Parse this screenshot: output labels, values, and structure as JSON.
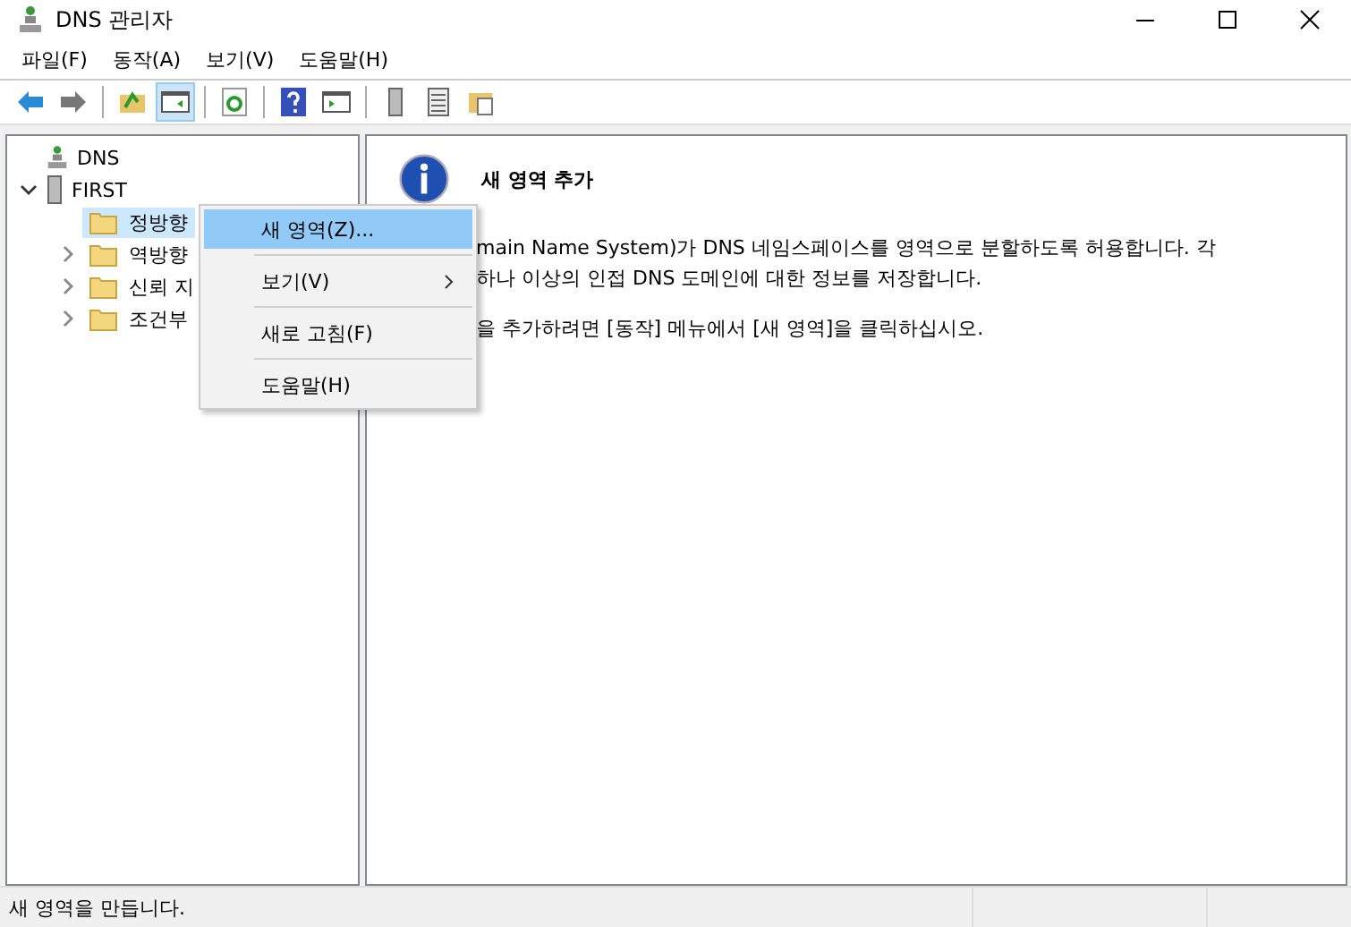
{
  "window": {
    "title": "DNS 관리자"
  },
  "menu": [
    "파일(F)",
    "동작(A)",
    "보기(V)",
    "도움말(H)"
  ],
  "toolbar": [
    {
      "kind": "back",
      "pressed": false
    },
    {
      "kind": "forward",
      "pressed": false
    },
    {
      "kind": "sep"
    },
    {
      "kind": "up",
      "pressed": false
    },
    {
      "kind": "pane",
      "pressed": true
    },
    {
      "kind": "sep"
    },
    {
      "kind": "refresh",
      "pressed": false
    },
    {
      "kind": "sep"
    },
    {
      "kind": "help",
      "pressed": false
    },
    {
      "kind": "action",
      "pressed": false
    },
    {
      "kind": "sep"
    },
    {
      "kind": "server",
      "pressed": false
    },
    {
      "kind": "list",
      "pressed": false
    },
    {
      "kind": "folder",
      "pressed": false
    }
  ],
  "tree": {
    "label": "DNS",
    "children": [
      {
        "label": "FIRST",
        "expanded": true,
        "children": [
          {
            "label": "정방향",
            "selected": true,
            "expandable": false
          },
          {
            "label": "역방향",
            "selected": false,
            "expandable": true
          },
          {
            "label": "신뢰 지",
            "selected": false,
            "expandable": true
          },
          {
            "label": "조건부",
            "selected": false,
            "expandable": true
          }
        ]
      }
    ]
  },
  "context_menu": [
    {
      "label": "새 영역(Z)...",
      "selected": true,
      "submenu": false
    },
    {
      "label": "보기(V)",
      "selected": false,
      "submenu": true
    },
    {
      "label": "새로 고침(F)",
      "selected": false,
      "submenu": false
    },
    {
      "label": "도움말(H)",
      "selected": false,
      "submenu": false
    }
  ],
  "detail": {
    "title": "새 영역 추가",
    "paragraphs": [
      [
        "main Name System)가 DNS 네임스페이스를 영역으로 분할하도록 허용합니다. 각",
        "하나 이상의 인접 DNS 도메인에 대한 정보를 저장합니다."
      ],
      [
        "을 추가하려면 [동작] 메뉴에서 [새 영역]을 클릭하십시오."
      ]
    ]
  },
  "status_bar": "새 영역을 만듭니다."
}
